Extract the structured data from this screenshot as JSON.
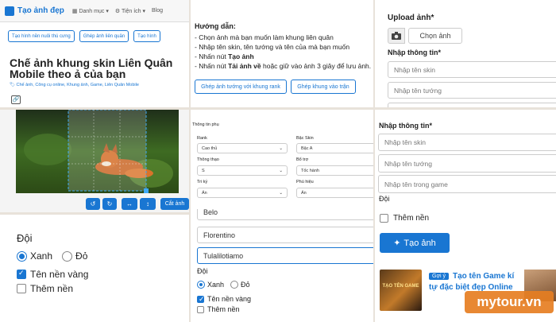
{
  "nav": {
    "logo": "Tạo ảnh đẹp",
    "menu1": "Danh mục",
    "menu2": "Tiện ích",
    "menu3": "Blog"
  },
  "toolbar": {
    "btn1": "Tạo hình nền nuôi thú cưng",
    "btn2": "Ghép ảnh liên quân",
    "btn3": "Tạo hình"
  },
  "article": {
    "title": "Chế ảnh khung skin Liên Quân Mobile theo ả của bạn",
    "tags": "Chế ảnh, Công cụ online, Khung ảnh, Game, Liên Quân Mobile"
  },
  "editor": {
    "crop_label": "Cắt ảnh"
  },
  "guide": {
    "heading": "Hướng dẫn:",
    "line1": "- Chọn ảnh mà bạn muốn làm khung liên quân",
    "line2": "- Nhập tên skin, tên tướng và tên của mà bạn muốn",
    "line3_prefix": "- Nhấn nút ",
    "line3_bold": "Tạo ảnh",
    "line4_prefix": "- Nhấn nút ",
    "line4_bold": "Tải ảnh về",
    "line4_suffix": " hoặc giữ vào ảnh 3 giây để lưu ảnh.",
    "btn_rank": "Ghép ảnh tướng với khung rank",
    "btn_frame": "Ghép khung vào trận"
  },
  "upload": {
    "label": "Upload ảnh*",
    "choose_btn": "Chọn ảnh",
    "info_label": "Nhập thông tin*",
    "skin_placeholder": "Nhập tên skin",
    "hero_placeholder": "Nhập tên tướng"
  },
  "extra": {
    "heading": "Thông tin phụ",
    "rank_label": "Rank",
    "rank_value": "Cao thủ",
    "skin_level_label": "Bậc Skin",
    "skin_level_value": "Bậc A",
    "mastery_label": "Thông thạo",
    "mastery_value": "S",
    "spell_label": "Bổ trợ",
    "spell_value": "Tốc hành",
    "friend_label": "Tri kỷ",
    "friend_value": "Ẩn",
    "badge_label": "Phù hiệu",
    "badge_value": "Ẩn"
  },
  "form_right": {
    "info_label": "Nhập thông tin*",
    "skin_placeholder": "Nhập tên skin",
    "hero_placeholder": "Nhập tên tướng",
    "ingame_placeholder": "Nhập tên trong game",
    "team_label": "Đội",
    "bg_label": "Thêm nền",
    "create_btn": "Tạo ảnh"
  },
  "team_left": {
    "label": "Đội",
    "blue": "Xanh",
    "red": "Đỏ",
    "gold_bg": "Tên nền vàng",
    "add_bg": "Thêm nền"
  },
  "filled": {
    "skin_value": "Belo",
    "hero_value": "Florentino",
    "name_value": "Tulalilotiamo",
    "team_label": "Đội",
    "blue": "Xanh",
    "red": "Đỏ",
    "gold_bg": "Tên nền vàng",
    "add_bg": "Thêm nền"
  },
  "promo": {
    "badge": "Gợi ý",
    "title": "Tạo tên Game kí tự đặc biệt đẹp Online",
    "thumb_text": "TẠO TÊN GAME"
  },
  "watermark": "mytour.vn",
  "colors": {
    "primary": "#1976d2",
    "accent_orange": "#e67e22"
  }
}
